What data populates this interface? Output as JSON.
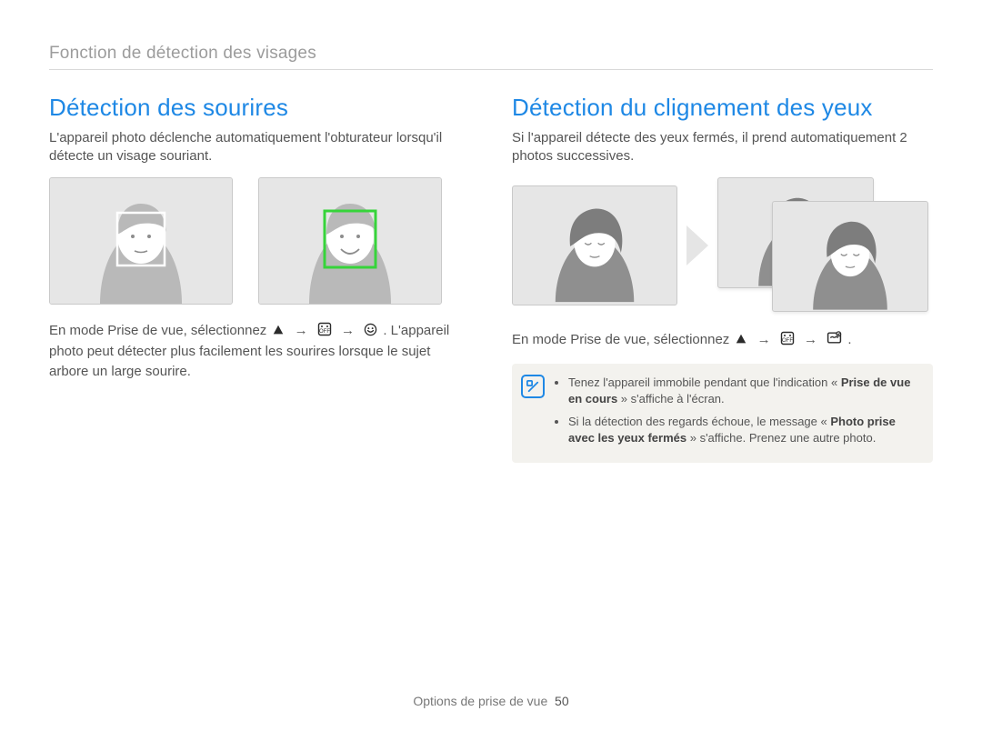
{
  "breadcrumb": "Fonction de détection des visages",
  "arrow": "→",
  "left": {
    "heading": "Détection des sourires",
    "intro": "L'appareil photo déclenche automatiquement l'obturateur lorsqu'il détecte un visage souriant.",
    "instr_before": "En mode Prise de vue, sélectionnez ",
    "instr_after": ". L'appareil photo peut détecter plus facilement les sourires lorsque le sujet arbore un large sourire."
  },
  "right": {
    "heading": "Détection du clignement des yeux",
    "intro": "Si l'appareil détecte des yeux fermés, il prend automatiquement 2 photos successives.",
    "instr_before": "En mode Prise de vue, sélectionnez ",
    "instr_after": ".",
    "notes": [
      {
        "pre": "Tenez l'appareil immobile pendant que l'indication « ",
        "bold": "Prise de vue en cours",
        "post": " » s'affiche à l'écran."
      },
      {
        "pre": "Si la détection des regards échoue, le message « ",
        "bold": "Photo prise avec les yeux fermés",
        "post": " » s'affiche. Prenez une autre photo."
      }
    ]
  },
  "footer": {
    "section": "Options de prise de vue",
    "page": "50"
  }
}
